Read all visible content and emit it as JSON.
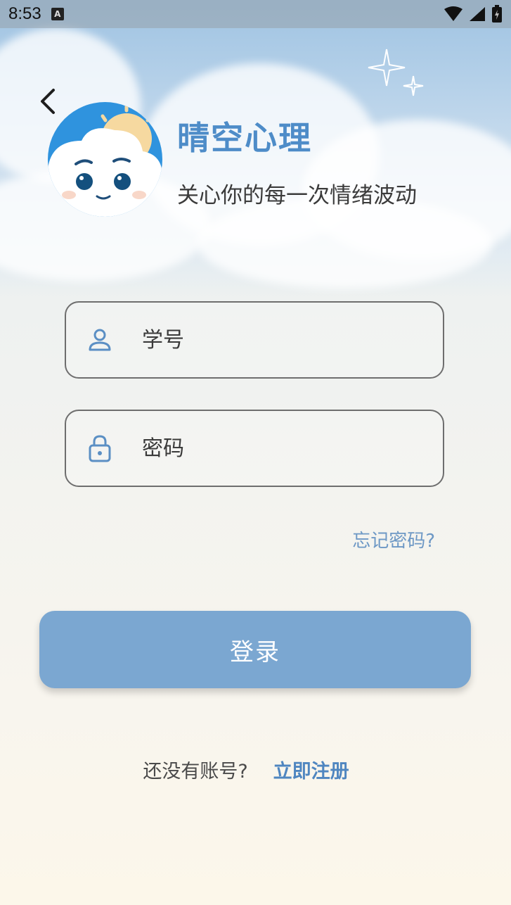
{
  "status_bar": {
    "time": "8:53",
    "notification_icon": "a-badge-icon",
    "icons": [
      "wifi-icon",
      "signal-icon",
      "battery-icon"
    ]
  },
  "header": {
    "back_icon": "chevron-left-icon",
    "app_title": "晴空心理",
    "slogan": "关心你的每一次情绪波动"
  },
  "form": {
    "student_id": {
      "placeholder": "学号",
      "value": "",
      "icon": "user-icon"
    },
    "password": {
      "placeholder": "密码",
      "value": "",
      "icon": "lock-icon"
    },
    "forgot_password": "忘记密码?",
    "login_label": "登录"
  },
  "register": {
    "prompt": "还没有账号?",
    "link": "立即注册"
  },
  "colors": {
    "accent": "#4e8cc8",
    "button": "#7ba7d1",
    "link": "#6d98c5"
  }
}
